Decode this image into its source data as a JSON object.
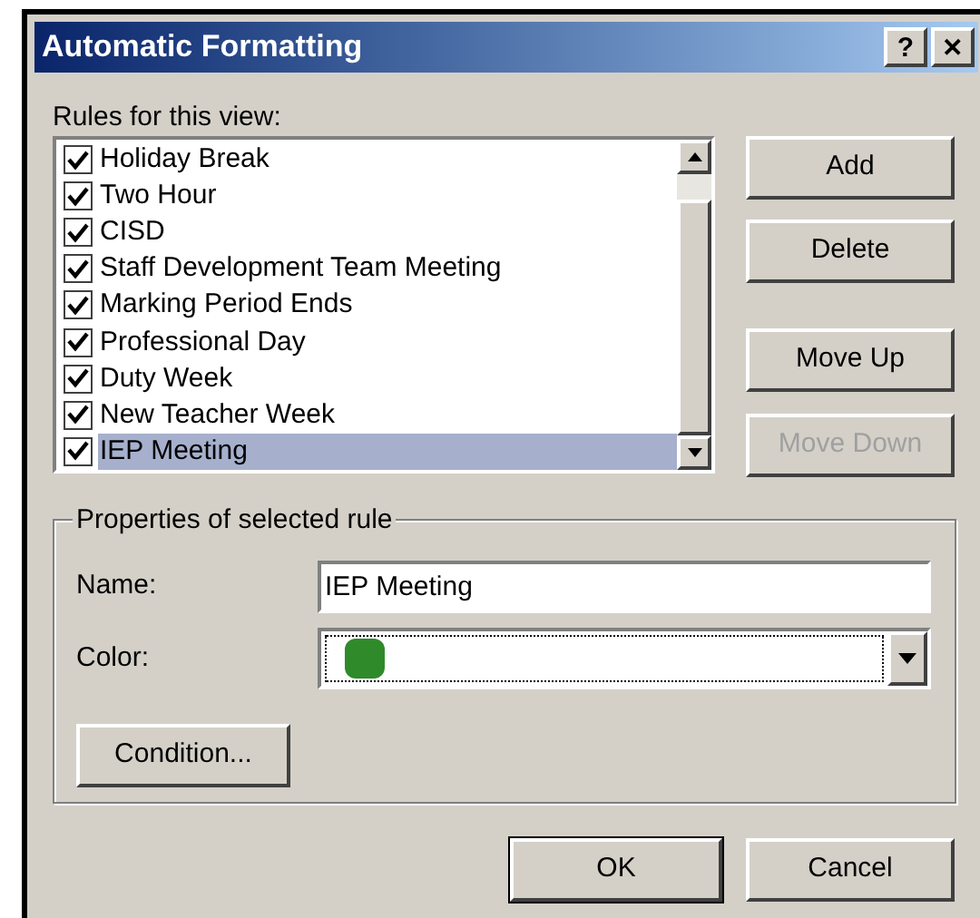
{
  "window": {
    "title": "Automatic Formatting",
    "help_button": "?",
    "close_button": "✕"
  },
  "rules_label": "Rules for this view:",
  "rules": [
    {
      "name": "Holiday Break",
      "checked": true,
      "selected": false
    },
    {
      "name": "Two Hour",
      "checked": true,
      "selected": false
    },
    {
      "name": "CISD",
      "checked": true,
      "selected": false
    },
    {
      "name": "Staff Development Team Meeting",
      "checked": true,
      "selected": false
    },
    {
      "name": "Marking Period Ends",
      "checked": true,
      "selected": false
    },
    {
      "name": "Professional Day",
      "checked": true,
      "selected": false
    },
    {
      "name": "Duty Week",
      "checked": true,
      "selected": false
    },
    {
      "name": "New Teacher Week",
      "checked": true,
      "selected": false
    },
    {
      "name": "IEP Meeting",
      "checked": true,
      "selected": true
    }
  ],
  "side_buttons": [
    {
      "label": "Add",
      "disabled": false
    },
    {
      "label": "Delete",
      "disabled": false
    },
    {
      "label": "Move Up",
      "disabled": false
    },
    {
      "label": "Move Down",
      "disabled": true
    }
  ],
  "properties": {
    "title": "Properties of selected rule",
    "name_label": "Name:",
    "name_value": "IEP Meeting",
    "color_label": "Color:",
    "color": "#2f8a2a",
    "condition_button": "Condition..."
  },
  "buttons": [
    "OK",
    "Cancel"
  ]
}
